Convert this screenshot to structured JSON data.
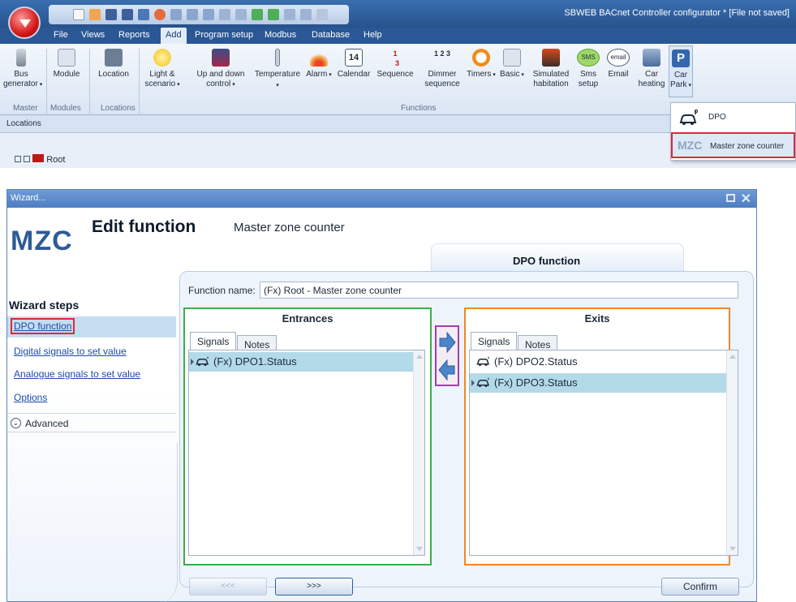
{
  "window_title": "SBWEB BACnet Controller configurator * [File not saved]",
  "menu": [
    "File",
    "Views",
    "Reports",
    "Add",
    "Program setup",
    "Modbus",
    "Database",
    "Help"
  ],
  "menu_active": "Add",
  "ribbon": {
    "buttons": [
      {
        "label": "Bus\ngenerator",
        "icon": "bus-generator-icon",
        "dropdown": true
      },
      {
        "label": "Module",
        "icon": "module-icon"
      },
      {
        "label": "Location",
        "icon": "location-icon"
      },
      {
        "label": "Light &\nscenario",
        "icon": "light-bulb-icon",
        "dropdown": true
      },
      {
        "label": "Up and down\ncontrol",
        "icon": "blind-icon",
        "dropdown": true
      },
      {
        "label": "Temperature",
        "icon": "thermometer-icon",
        "dropdown": true
      },
      {
        "label": "Alarm",
        "icon": "alarm-icon",
        "dropdown": true
      },
      {
        "label": "Calendar",
        "icon": "calendar-icon"
      },
      {
        "label": "Sequence",
        "icon": "sequence-icon"
      },
      {
        "label": "Dimmer\nsequence",
        "icon": "dimmer-sequence-icon"
      },
      {
        "label": "Timers",
        "icon": "timer-icon",
        "dropdown": true
      },
      {
        "label": "Basic",
        "icon": "basic-icon",
        "dropdown": true
      },
      {
        "label": "Simulated\nhabitation",
        "icon": "simulated-habitation-icon"
      },
      {
        "label": "Sms\nsetup",
        "icon": "sms-icon"
      },
      {
        "label": "Email",
        "icon": "email-icon"
      },
      {
        "label": "Car\nheating",
        "icon": "car-heating-icon"
      },
      {
        "label": "Car\nPark",
        "icon": "car-park-icon",
        "dropdown": true
      }
    ],
    "groups": [
      "Master",
      "Modules",
      "Locations",
      "Functions"
    ],
    "calendar_day": "14",
    "sequence_digits": "1 2 3"
  },
  "locations_label": "Locations",
  "tree_root": "Root",
  "carpark_menu": [
    {
      "label": "DPO",
      "icon": "car-sensor-icon"
    },
    {
      "label": "Master zone counter",
      "icon_text": "MZC",
      "selected": true
    }
  ],
  "wizard": {
    "title": "Wizard...",
    "logo": "MZC",
    "heading": "Edit function",
    "subheading": "Master zone counter",
    "step_tab": "DPO function",
    "steps_header": "Wizard steps",
    "steps": [
      "DPO function",
      "Digital signals to set value",
      "Analogue signals to set value",
      "Options"
    ],
    "active_step": 0,
    "advanced_label": "Advanced",
    "function_name_label": "Function name:",
    "function_name_value": "(Fx) Root - Master zone counter",
    "entrances": {
      "title": "Entrances",
      "tabs": [
        "Signals",
        "Notes"
      ],
      "items": [
        {
          "text": "(Fx) DPO1.Status",
          "selected": true
        }
      ]
    },
    "exits": {
      "title": "Exits",
      "tabs": [
        "Signals",
        "Notes"
      ],
      "items": [
        {
          "text": "(Fx) DPO2.Status",
          "selected": false
        },
        {
          "text": "(Fx) DPO3.Status",
          "selected": true
        }
      ]
    },
    "buttons": {
      "prev": "<<<",
      "next": ">>>",
      "confirm": "Confirm"
    }
  },
  "colors": {
    "entrances_border": "#3aae4a",
    "exits_border": "#f0862a",
    "move_border": "#a53ea8",
    "highlight_red": "#e0263b",
    "selection": "#b3dae8"
  }
}
